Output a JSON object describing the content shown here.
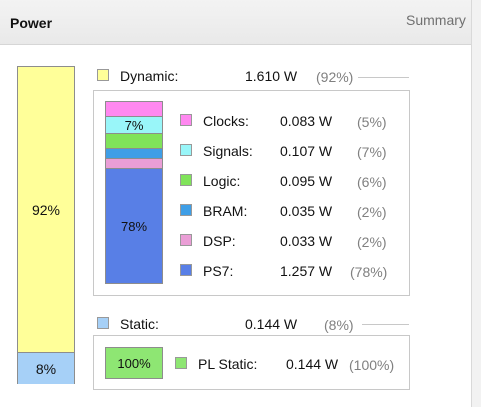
{
  "header": {
    "title": "Power",
    "summary_link": "Summary"
  },
  "main_bar": {
    "dynamic_pct_label": "92%",
    "static_pct_label": "8%",
    "dynamic_fraction": 0.92,
    "static_fraction": 0.08
  },
  "dynamic": {
    "label": "Dynamic:",
    "value": "1.610 W",
    "pct": "(92%)",
    "color": "#ffff99"
  },
  "dynamic_bar": {
    "clocks_label": "7%",
    "ps7_label": "78%"
  },
  "components": [
    {
      "name": "Clocks:",
      "value": "0.083 W",
      "pct": "(5%)",
      "color": "#ff88f0",
      "icon": "clocks-swatch"
    },
    {
      "name": "Signals:",
      "value": "0.107 W",
      "pct": "(7%)",
      "color": "#99f6f9",
      "icon": "signals-swatch"
    },
    {
      "name": "Logic:",
      "value": "0.095 W",
      "pct": "(6%)",
      "color": "#80e35a",
      "icon": "logic-swatch"
    },
    {
      "name": "BRAM:",
      "value": "0.035 W",
      "pct": "(2%)",
      "color": "#3f9ee6",
      "icon": "bram-swatch"
    },
    {
      "name": "DSP:",
      "value": "0.033 W",
      "pct": "(2%)",
      "color": "#ea9ed6",
      "icon": "dsp-swatch"
    },
    {
      "name": "PS7:",
      "value": "1.257 W",
      "pct": "(78%)",
      "color": "#587fe6",
      "icon": "ps7-swatch"
    }
  ],
  "static": {
    "label": "Static:",
    "value": "0.144 W",
    "pct": "(8%)",
    "color": "#a6d0f7"
  },
  "static_bar": {
    "label": "100%"
  },
  "pl_static": {
    "label": "PL Static:",
    "value": "0.144 W",
    "pct": "(100%)",
    "color": "#8ee673"
  }
}
